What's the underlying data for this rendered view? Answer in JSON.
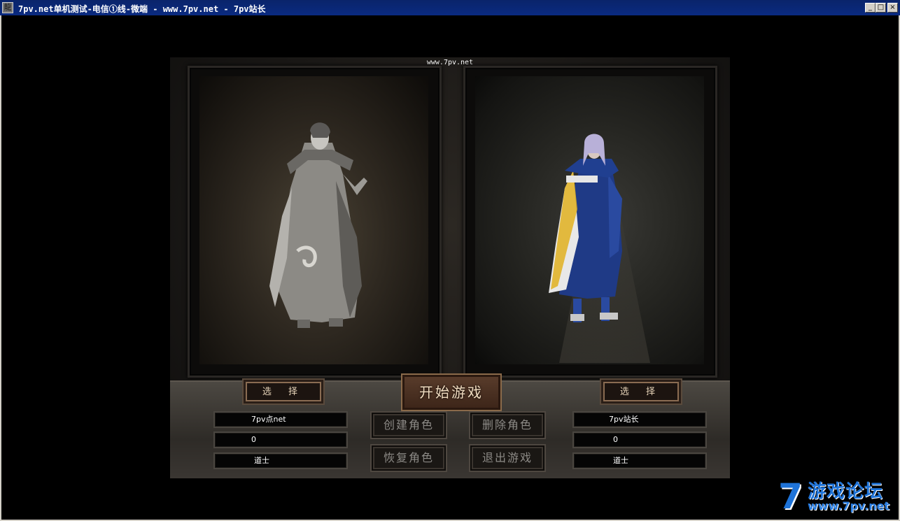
{
  "window": {
    "title": "7pv.net单机测试-电信①线-微端  - www.7pv.net - 7pv站长",
    "icon": "app-icon",
    "controls": {
      "minimize": "_",
      "maximize": "□",
      "close": "×"
    }
  },
  "game": {
    "site_label": "www.7pv.net",
    "start_button": "开始游戏",
    "left": {
      "select_label": "选 择",
      "name": "7pv点net",
      "level": "0",
      "job": "道士"
    },
    "right": {
      "select_label": "选 择",
      "name": "7pv站长",
      "level": "0",
      "job": "道士"
    },
    "actions": {
      "create": "创建角色",
      "delete": "删除角色",
      "restore": "恢复角色",
      "exit": "退出游戏"
    }
  },
  "watermark": {
    "logo_number": "7",
    "text": "游戏论坛",
    "url": "www.7pv.net"
  }
}
